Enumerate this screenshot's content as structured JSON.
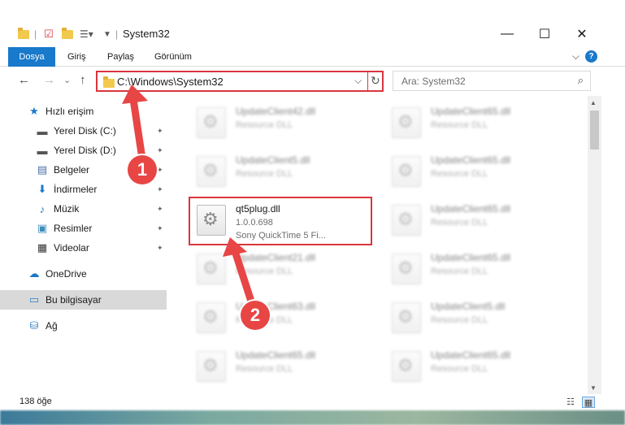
{
  "window": {
    "title": "System32",
    "minimize": "—",
    "maximize": "☐",
    "close": "✕"
  },
  "ribbon": {
    "tabs": [
      "Dosya",
      "Giriş",
      "Paylaş",
      "Görünüm"
    ],
    "help": "?",
    "collapse": "⌵"
  },
  "nav": {
    "back": "←",
    "forward": "→",
    "recent": "⌄",
    "up": "↑",
    "address": "C:\\Windows\\System32",
    "address_dropdown": "⌵",
    "refresh": "↻",
    "search_placeholder": "Ara: System32",
    "search_icon": "⌕"
  },
  "sidebar": {
    "items": [
      {
        "label": "Hızlı erişim",
        "icon": "star-icon",
        "glyph": "★",
        "color": "#1979ca",
        "pinned": false
      },
      {
        "label": "Yerel Disk (C:)",
        "icon": "drive-c-icon",
        "glyph": "▬",
        "color": "#555555",
        "pinned": true
      },
      {
        "label": "Yerel Disk (D:)",
        "icon": "drive-d-icon",
        "glyph": "▬",
        "color": "#555555",
        "pinned": true
      },
      {
        "label": "Belgeler",
        "icon": "documents-icon",
        "glyph": "▤",
        "color": "#4a6fa5",
        "pinned": true
      },
      {
        "label": "İndirmeler",
        "icon": "downloads-icon",
        "glyph": "⬇",
        "color": "#1979ca",
        "pinned": true
      },
      {
        "label": "Müzik",
        "icon": "music-icon",
        "glyph": "♪",
        "color": "#1979ca",
        "pinned": true
      },
      {
        "label": "Resimler",
        "icon": "pictures-icon",
        "glyph": "▣",
        "color": "#3c8dbc",
        "pinned": true
      },
      {
        "label": "Videolar",
        "icon": "videos-icon",
        "glyph": "▦",
        "color": "#333333",
        "pinned": true
      },
      {
        "label": "OneDrive",
        "icon": "onedrive-icon",
        "glyph": "☁",
        "color": "#1979ca",
        "pinned": false
      },
      {
        "label": "Bu bilgisayar",
        "icon": "this-pc-icon",
        "glyph": "▭",
        "color": "#2f7fc1",
        "pinned": false,
        "selected": true
      },
      {
        "label": "Ağ",
        "icon": "network-icon",
        "glyph": "⛁",
        "color": "#2f7fc1",
        "pinned": false
      }
    ],
    "pin_glyph": "📌"
  },
  "files": [
    {
      "name": "UpdateClient42.dll",
      "line2": "Resource DLL",
      "col": 0,
      "row": 0,
      "blurred": true
    },
    {
      "name": "UpdateClient65.dll",
      "line2": "Resource DLL",
      "col": 1,
      "row": 0,
      "blurred": true
    },
    {
      "name": "UpdateClient5.dll",
      "line2": "Resource DLL",
      "col": 0,
      "row": 1,
      "blurred": true
    },
    {
      "name": "UpdateClient65.dll",
      "line2": "Resource DLL",
      "col": 1,
      "row": 1,
      "blurred": true
    },
    {
      "name": "qt5plug.dll",
      "line2": "1.0.0.698",
      "line3": "Sony QuickTime 5 Fi...",
      "col": 0,
      "row": 2,
      "blurred": false,
      "highlighted": true
    },
    {
      "name": "UpdateClient65.dll",
      "line2": "Resource DLL",
      "col": 1,
      "row": 2,
      "blurred": true
    },
    {
      "name": "UpdateClient21.dll",
      "line2": "Resource DLL",
      "col": 0,
      "row": 3,
      "blurred": true
    },
    {
      "name": "UpdateClient65.dll",
      "line2": "Resource DLL",
      "col": 1,
      "row": 3,
      "blurred": true
    },
    {
      "name": "UpdateClient63.dll",
      "line2": "Resource DLL",
      "col": 0,
      "row": 4,
      "blurred": true
    },
    {
      "name": "UpdateClient5.dll",
      "line2": "Resource DLL",
      "col": 1,
      "row": 4,
      "blurred": true
    },
    {
      "name": "UpdateClient65.dll",
      "line2": "Resource DLL",
      "col": 0,
      "row": 5,
      "blurred": true
    },
    {
      "name": "UpdateClient65.dll",
      "line2": "Resource DLL",
      "col": 1,
      "row": 5,
      "blurred": true
    }
  ],
  "status": {
    "count": "138 öğe",
    "details_view": "☷",
    "tiles_view": "▦"
  },
  "annotations": {
    "step1": "1",
    "step2": "2",
    "color": "#e84545"
  },
  "scroll": {
    "up": "▲",
    "down": "▼"
  }
}
